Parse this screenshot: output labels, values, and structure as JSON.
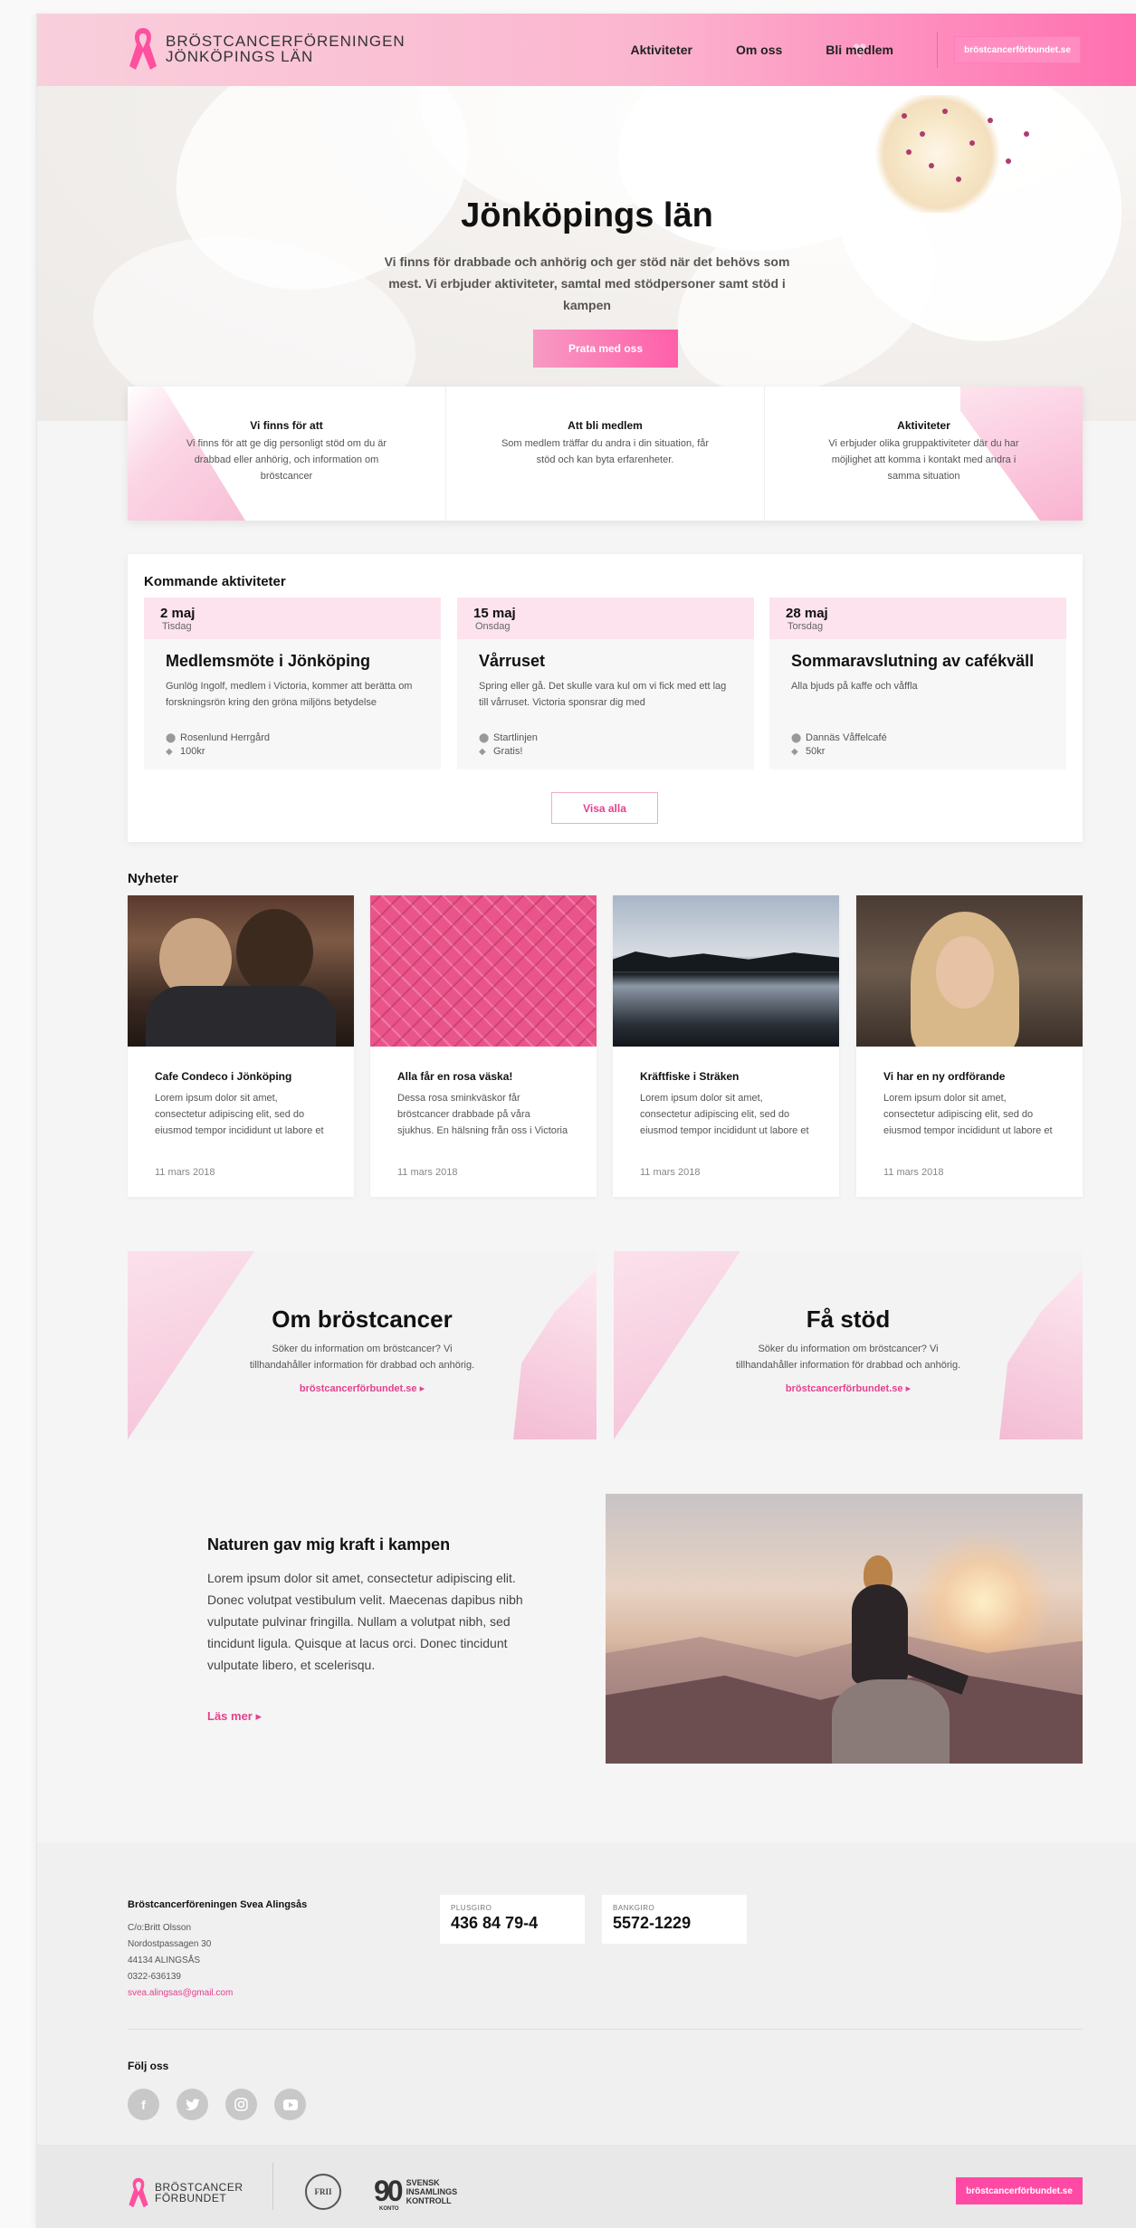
{
  "header": {
    "logo_line1": "BRÖSTCANCERFÖRENINGEN",
    "logo_line2": "JÖNKÖPINGS LÄN",
    "nav": [
      "Aktiviteter",
      "Om oss",
      "Bli medlem"
    ],
    "cta": "bröstcancerförbundet.se"
  },
  "hero": {
    "title": "Jönköpings län",
    "subtitle": "Vi finns för drabbade och anhörig och ger stöd när det behövs som mest. Vi erbjuder aktiviteter, samtal med stödpersoner samt stöd i kampen",
    "button": "Prata med oss"
  },
  "info_cards": [
    {
      "title": "Vi finns för att",
      "text": "Vi finns för att ge dig personligt stöd om du är drabbad eller anhörig, och information om bröstcancer"
    },
    {
      "title": "Att bli medlem",
      "text": "Som medlem träffar du andra i din situation, får stöd och kan byta erfarenheter."
    },
    {
      "title": "Aktiviteter",
      "text": "Vi erbjuder olika gruppaktiviteter där du har möjlighet att komma i kontakt med andra i samma situation"
    }
  ],
  "activities": {
    "heading": "Kommande aktiviteter",
    "items": [
      {
        "date": "2 maj",
        "day": "Tisdag",
        "title": "Medlemsmöte i Jönköping",
        "desc": "Gunlög Ingolf, medlem i Victoria, kommer att berätta om forskningsrön kring den gröna miljöns betydelse",
        "place": "Rosenlund Herrgård",
        "price": "100kr"
      },
      {
        "date": "15 maj",
        "day": "Onsdag",
        "title": "Vårruset",
        "desc": "Spring eller gå. Det skulle vara kul om vi fick med ett lag till vårruset. Victoria sponsrar dig med",
        "place": "Startlinjen",
        "price": "Gratis!"
      },
      {
        "date": "28 maj",
        "day": "Torsdag",
        "title": "Sommaravslutning av cafékväll",
        "desc": "Alla bjuds på kaffe och våffla",
        "place": "Dannäs Våffelcafé",
        "price": "50kr"
      }
    ],
    "show_all": "Visa alla"
  },
  "news": {
    "heading": "Nyheter",
    "items": [
      {
        "title": "Cafe Condeco i Jönköping",
        "text": "Lorem ipsum dolor sit amet, consectetur adipiscing elit, sed do eiusmod tempor incididunt ut labore et",
        "date": "11 mars 2018"
      },
      {
        "title": "Alla får en rosa väska!",
        "text": "Dessa rosa sminkväskor får bröstcancer drabbade på våra sjukhus. En hälsning från oss i Victoria",
        "date": "11 mars 2018"
      },
      {
        "title": "Kräftfiske i Sträken",
        "text": "Lorem ipsum dolor sit amet, consectetur adipiscing elit, sed do eiusmod tempor incididunt ut labore et",
        "date": "11 mars 2018"
      },
      {
        "title": "Vi har en ny ordförande",
        "text": "Lorem ipsum dolor sit amet, consectetur adipiscing elit, sed do eiusmod tempor incididunt ut labore et",
        "date": "11 mars 2018"
      }
    ]
  },
  "promos": [
    {
      "title": "Om bröstcancer",
      "text": "Söker du information om bröstcancer? Vi tillhandahåller information för drabbad och anhörig.",
      "link": "bröstcancerförbundet.se"
    },
    {
      "title": "Få stöd",
      "text": "Söker du information om bröstcancer? Vi tillhandahåller information för drabbad och anhörig.",
      "link": "bröstcancerförbundet.se"
    }
  ],
  "story": {
    "title": "Naturen gav mig kraft i kampen",
    "body": "Lorem ipsum dolor sit amet, consectetur adipiscing elit. Donec volutpat vestibulum velit. Maecenas dapibus nibh vulputate pulvinar fringilla. Nullam a volutpat nibh, sed tincidunt ligula. Quisque at lacus orci. Donec tincidunt vulputate libero, et scelerisqu.",
    "link": "Läs mer"
  },
  "footer": {
    "org": "Bröstcancerföreningen Svea Alingsås",
    "addr1": "C/o:Britt Olsson",
    "addr2": "Nordostpassagen 30",
    "addr3": "44134 ALINGSÅS",
    "phone": "0322-636139",
    "email": "svea.alingsas@gmail.com",
    "plusgiro_label": "PLUSGIRO",
    "plusgiro": "436 84 79-4",
    "bankgiro_label": "BANKGIRO",
    "bankgiro": "5572-1229",
    "follow": "Följ oss",
    "social": [
      "facebook-icon",
      "twitter-icon",
      "instagram-icon",
      "youtube-icon"
    ]
  },
  "bottom": {
    "logo_line1": "BRÖSTCANCER",
    "logo_line2": "FÖRBUNDET",
    "frii": "FRII",
    "ninety": "90",
    "konto": "KONTO",
    "ninety_l1": "SVENSK",
    "ninety_l2": "INSAMLINGS",
    "ninety_l3": "KONTROLL",
    "cta": "bröstcancerförbundet.se"
  },
  "colors": {
    "accent": "#ff4aa5",
    "pink_light": "#fde3ee",
    "link": "#e5408f"
  }
}
